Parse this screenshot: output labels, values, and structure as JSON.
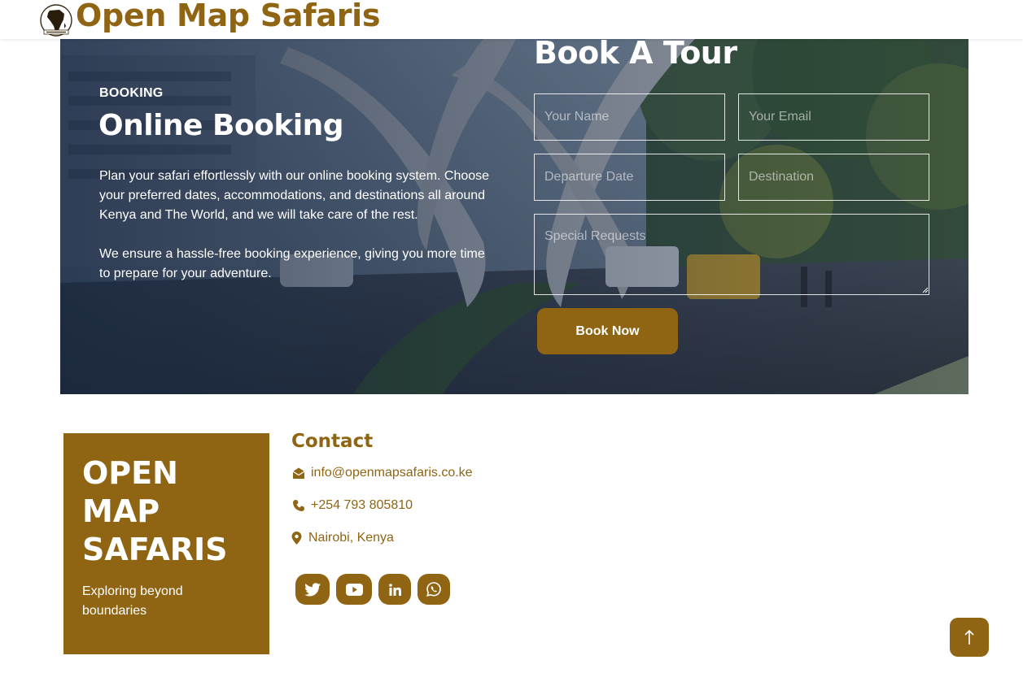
{
  "header": {
    "brand": "Open Map Safaris",
    "logo_icon": "africa-map-logo-icon"
  },
  "hero": {
    "eyebrow": "BOOKING",
    "title": "Online Booking",
    "paragraph_1": "Plan your safari effortlessly with our online booking system. Choose your preferred dates, accommodations, and destinations all around Kenya and The World, and we will take care of the rest.",
    "paragraph_2": "We ensure a hassle-free booking experience, giving you more time to prepare for your adventure.",
    "background_icon": "mombasa-tusks-photo"
  },
  "booking_form": {
    "title": "Book A Tour",
    "name_placeholder": "Your Name",
    "email_placeholder": "Your Email",
    "date_placeholder": "Departure Date",
    "destination_placeholder": "Destination",
    "requests_placeholder": "Special Requests",
    "submit_label": "Book Now"
  },
  "footer": {
    "brand_title": "OPEN MAP SAFARIS",
    "tagline": "Exploring beyond boundaries",
    "contact_title": "Contact",
    "email": "info@openmapsafaris.co.ke",
    "phone": "+254 793 805810",
    "location": "Nairobi, Kenya",
    "social": [
      "twitter-icon",
      "youtube-icon",
      "linkedin-icon",
      "whatsapp-icon"
    ]
  },
  "colors": {
    "accent": "#8f6513",
    "overlay": "#14243e",
    "text_light": "#ffffff"
  }
}
